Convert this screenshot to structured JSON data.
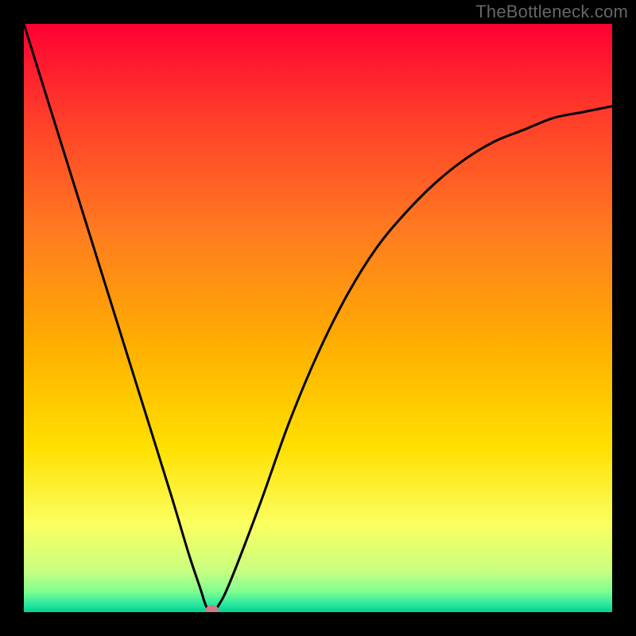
{
  "watermark": "TheBottleneck.com",
  "chart_data": {
    "type": "line",
    "title": "",
    "xlabel": "",
    "ylabel": "",
    "xlim": [
      0,
      100
    ],
    "ylim": [
      0,
      100
    ],
    "series": [
      {
        "name": "curve",
        "x": [
          0,
          5,
          10,
          15,
          20,
          25,
          28,
          30,
          31,
          32,
          33,
          35,
          40,
          45,
          50,
          55,
          60,
          65,
          70,
          75,
          80,
          85,
          90,
          95,
          100
        ],
        "values": [
          100,
          84,
          68,
          52,
          36,
          20,
          10,
          4,
          1,
          0,
          1,
          5,
          18,
          32,
          44,
          54,
          62,
          68,
          73,
          77,
          80,
          82,
          84,
          85,
          86
        ]
      }
    ],
    "marker": {
      "x": 32,
      "y": 0
    },
    "gradient_stops": [
      {
        "offset": 0.0,
        "color": "#ff0033"
      },
      {
        "offset": 0.15,
        "color": "#ff3a2a"
      },
      {
        "offset": 0.35,
        "color": "#ff7a20"
      },
      {
        "offset": 0.55,
        "color": "#ffb000"
      },
      {
        "offset": 0.72,
        "color": "#ffe000"
      },
      {
        "offset": 0.85,
        "color": "#fbff60"
      },
      {
        "offset": 0.93,
        "color": "#c8ff80"
      },
      {
        "offset": 0.965,
        "color": "#7fff90"
      },
      {
        "offset": 0.985,
        "color": "#30e9a0"
      },
      {
        "offset": 1.0,
        "color": "#00d28f"
      }
    ]
  }
}
